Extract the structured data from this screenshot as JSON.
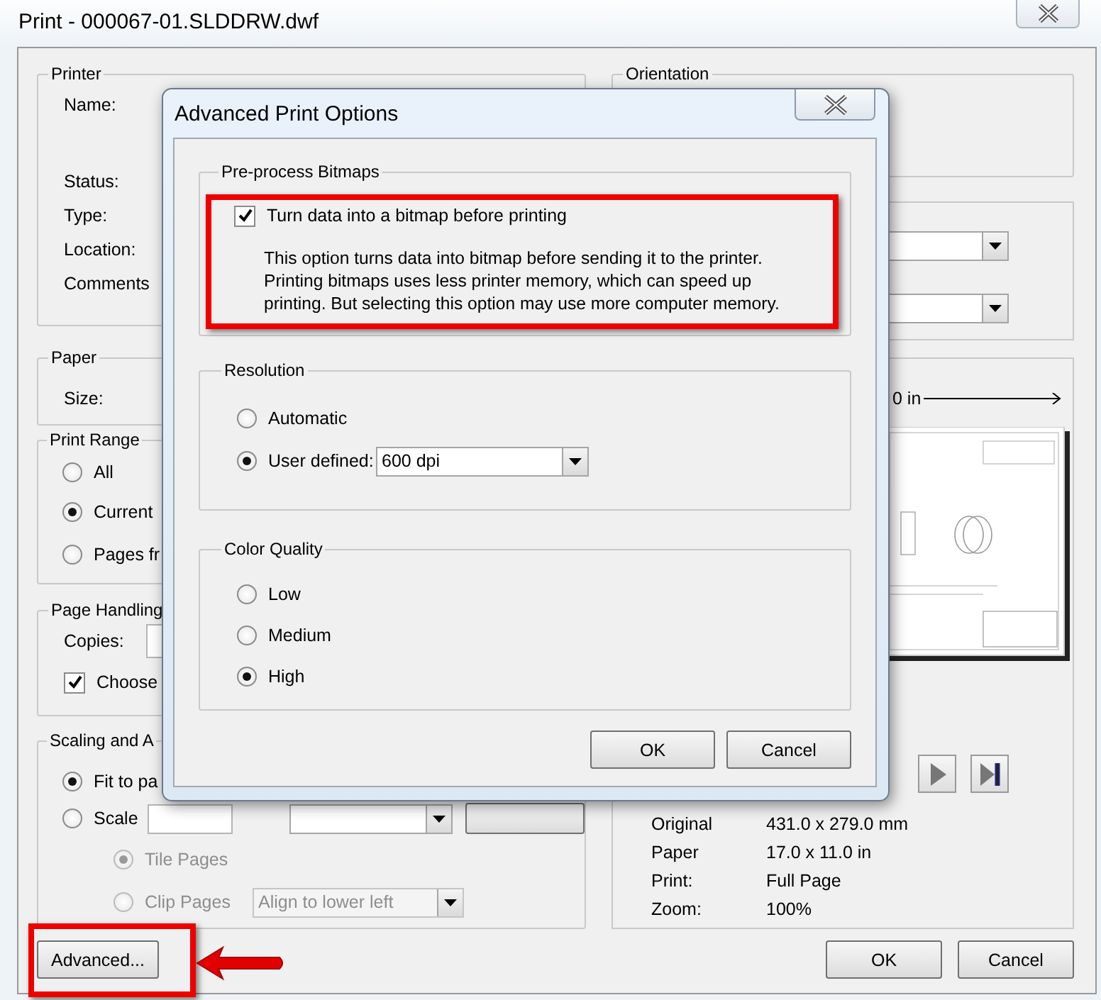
{
  "window": {
    "title": "Print - 000067-01.SLDDRW.dwf"
  },
  "printer": {
    "title": "Printer",
    "labels": [
      "Name:",
      "Status:",
      "Type:",
      "Location:",
      "Comments"
    ]
  },
  "paper": {
    "title": "Paper",
    "labels": [
      "Size:"
    ]
  },
  "print_range": {
    "title": "Print Range",
    "options": [
      {
        "label": "All",
        "selected": false
      },
      {
        "label": "Current",
        "selected": true
      },
      {
        "label": "Pages fr",
        "selected": false
      }
    ]
  },
  "page_handling": {
    "title": "Page Handling",
    "copies_label": "Copies:",
    "choose": {
      "label": "Choose",
      "checked": true
    }
  },
  "scaling": {
    "title": "Scaling and A",
    "options": [
      {
        "label": "Fit to pa",
        "selected": true
      },
      {
        "label": "Scale",
        "selected": false
      }
    ],
    "tile_options": [
      {
        "label": "Tile Pages",
        "selected": true,
        "disabled": true
      },
      {
        "label": "Clip Pages",
        "selected": false,
        "disabled": true
      }
    ],
    "align": {
      "value": "Align to lower left",
      "disabled": true
    }
  },
  "advanced_button": "Advanced...",
  "orientation": {
    "title": "Orientation"
  },
  "preview": {
    "width_label": "0 in",
    "info": [
      {
        "label": "Original",
        "value": "431.0 x 279.0 mm"
      },
      {
        "label": "Paper",
        "value": "17.0 x 11.0 in"
      },
      {
        "label": "Print:",
        "value": "Full Page"
      },
      {
        "label": "Zoom:",
        "value": "100%"
      }
    ]
  },
  "buttons": [
    "OK",
    "Cancel"
  ],
  "dialog": {
    "title": "Advanced Print Options",
    "preprocess": {
      "title": "Pre-process Bitmaps",
      "checkbox": {
        "label": "Turn data into a bitmap before printing",
        "checked": true
      },
      "description": "This option turns data into bitmap before sending it to the printer.\nPrinting bitmaps uses less printer memory, which can speed up\nprinting. But selecting this option may use more computer memory."
    },
    "resolution": {
      "title": "Resolution",
      "options": [
        {
          "label": "Automatic",
          "selected": false
        },
        {
          "label": "User defined:",
          "selected": true
        }
      ],
      "dropdown": "600 dpi"
    },
    "color_quality": {
      "title": "Color Quality",
      "options": [
        {
          "label": "Low",
          "selected": false
        },
        {
          "label": "Medium",
          "selected": false
        },
        {
          "label": "High",
          "selected": true
        }
      ]
    },
    "buttons": [
      "OK",
      "Cancel"
    ]
  }
}
